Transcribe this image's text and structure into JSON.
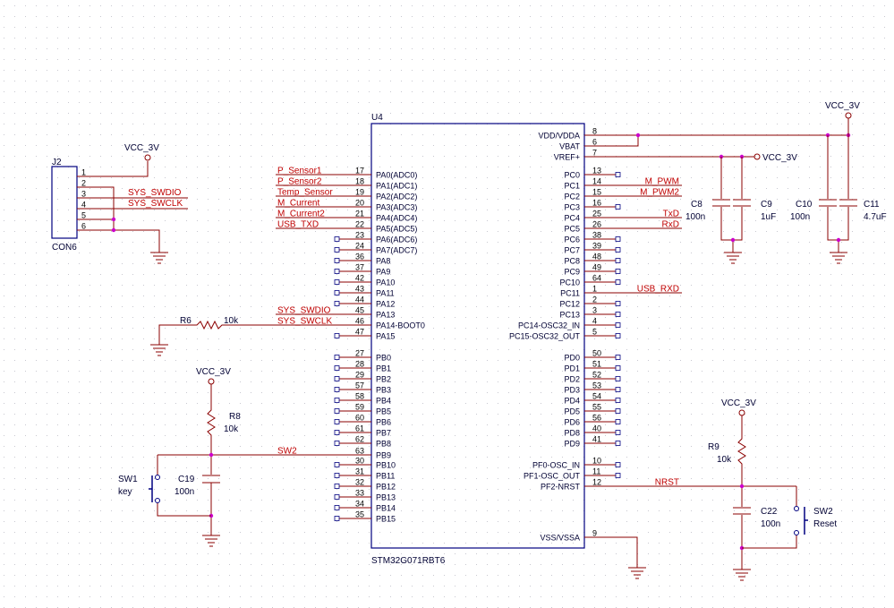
{
  "colors": {
    "wire": "#8b0000",
    "body": "#000080",
    "label": "#000033",
    "net": "#c00000",
    "junction": "#cc00cc"
  },
  "u4": {
    "ref": "U4",
    "part": "STM32G071RBT6",
    "left_pins": [
      {
        "num": "17",
        "name": "PA0(ADC0)",
        "net": "P_Sensor1"
      },
      {
        "num": "18",
        "name": "PA1(ADC1)",
        "net": "P_Sensor2"
      },
      {
        "num": "19",
        "name": "PA2(ADC2)",
        "net": "Temp_Sensor"
      },
      {
        "num": "20",
        "name": "PA3(ADC3)",
        "net": "M_Current"
      },
      {
        "num": "21",
        "name": "PA4(ADC4)",
        "net": "M_Current2"
      },
      {
        "num": "22",
        "name": "PA5(ADC5)",
        "net": "USB_TXD"
      },
      {
        "num": "23",
        "name": "PA6(ADC6)",
        "net": ""
      },
      {
        "num": "24",
        "name": "PA7(ADC7)",
        "net": ""
      },
      {
        "num": "36",
        "name": "PA8",
        "net": ""
      },
      {
        "num": "37",
        "name": "PA9",
        "net": ""
      },
      {
        "num": "42",
        "name": "PA10",
        "net": ""
      },
      {
        "num": "43",
        "name": "PA11",
        "net": ""
      },
      {
        "num": "44",
        "name": "PA12",
        "net": ""
      },
      {
        "num": "45",
        "name": "PA13",
        "net": "SYS_SWDIO"
      },
      {
        "num": "46",
        "name": "PA14-BOOT0",
        "net": "SYS_SWCLK"
      },
      {
        "num": "47",
        "name": "PA15",
        "net": ""
      },
      {
        "num": "27",
        "name": "PB0",
        "net": ""
      },
      {
        "num": "28",
        "name": "PB1",
        "net": ""
      },
      {
        "num": "29",
        "name": "PB2",
        "net": ""
      },
      {
        "num": "57",
        "name": "PB3",
        "net": ""
      },
      {
        "num": "58",
        "name": "PB4",
        "net": ""
      },
      {
        "num": "59",
        "name": "PB5",
        "net": ""
      },
      {
        "num": "60",
        "name": "PB6",
        "net": ""
      },
      {
        "num": "61",
        "name": "PB7",
        "net": ""
      },
      {
        "num": "62",
        "name": "PB8",
        "net": ""
      },
      {
        "num": "63",
        "name": "PB9",
        "net": "SW2"
      },
      {
        "num": "30",
        "name": "PB10",
        "net": ""
      },
      {
        "num": "31",
        "name": "PB11",
        "net": ""
      },
      {
        "num": "32",
        "name": "PB12",
        "net": ""
      },
      {
        "num": "33",
        "name": "PB13",
        "net": ""
      },
      {
        "num": "34",
        "name": "PB14",
        "net": ""
      },
      {
        "num": "35",
        "name": "PB15",
        "net": ""
      }
    ],
    "right_pins": [
      {
        "num": "8",
        "name": "VDD/VDDA",
        "net": ""
      },
      {
        "num": "6",
        "name": "VBAT",
        "net": ""
      },
      {
        "num": "7",
        "name": "VREF+",
        "net": ""
      },
      {
        "num": "13",
        "name": "PC0",
        "net": ""
      },
      {
        "num": "14",
        "name": "PC1",
        "net": "M_PWM"
      },
      {
        "num": "15",
        "name": "PC2",
        "net": "M_PWM2"
      },
      {
        "num": "16",
        "name": "PC3",
        "net": ""
      },
      {
        "num": "25",
        "name": "PC4",
        "net": "TxD"
      },
      {
        "num": "26",
        "name": "PC5",
        "net": "RxD"
      },
      {
        "num": "38",
        "name": "PC6",
        "net": ""
      },
      {
        "num": "39",
        "name": "PC7",
        "net": ""
      },
      {
        "num": "48",
        "name": "PC8",
        "net": ""
      },
      {
        "num": "49",
        "name": "PC9",
        "net": ""
      },
      {
        "num": "64",
        "name": "PC10",
        "net": ""
      },
      {
        "num": "1",
        "name": "PC11",
        "net": "USB_RXD"
      },
      {
        "num": "2",
        "name": "PC12",
        "net": ""
      },
      {
        "num": "3",
        "name": "PC13",
        "net": ""
      },
      {
        "num": "4",
        "name": "PC14-OSC32_IN",
        "net": ""
      },
      {
        "num": "5",
        "name": "PC15-OSC32_OUT",
        "net": ""
      },
      {
        "num": "50",
        "name": "PD0",
        "net": ""
      },
      {
        "num": "51",
        "name": "PD1",
        "net": ""
      },
      {
        "num": "52",
        "name": "PD2",
        "net": ""
      },
      {
        "num": "53",
        "name": "PD3",
        "net": ""
      },
      {
        "num": "54",
        "name": "PD4",
        "net": ""
      },
      {
        "num": "55",
        "name": "PD5",
        "net": ""
      },
      {
        "num": "56",
        "name": "PD6",
        "net": ""
      },
      {
        "num": "40",
        "name": "PD8",
        "net": ""
      },
      {
        "num": "41",
        "name": "PD9",
        "net": ""
      },
      {
        "num": "10",
        "name": "PF0-OSC_IN",
        "net": ""
      },
      {
        "num": "11",
        "name": "PF1-OSC_OUT",
        "net": ""
      },
      {
        "num": "12",
        "name": "PF2-NRST",
        "net": "NRST"
      },
      {
        "num": "9",
        "name": "VSS/VSSA",
        "net": ""
      }
    ]
  },
  "j2": {
    "ref": "J2",
    "part": "CON6",
    "pins": [
      "1",
      "2",
      "3",
      "4",
      "5",
      "6"
    ],
    "nets": [
      "SYS_SWDIO",
      "SYS_SWCLK"
    ],
    "power": "VCC_3V"
  },
  "vref_power": "VCC_3V",
  "vdd_power": "VCC_3V",
  "caps": {
    "c8": {
      "ref": "C8",
      "value": "100n"
    },
    "c9": {
      "ref": "C9",
      "value": "1uF"
    },
    "c10": {
      "ref": "C10",
      "value": "100n"
    },
    "c11": {
      "ref": "C11",
      "value": "4.7uF"
    },
    "c19": {
      "ref": "C19",
      "value": "100n"
    },
    "c22": {
      "ref": "C22",
      "value": "100n"
    }
  },
  "resistors": {
    "r6": {
      "ref": "R6",
      "value": "10k"
    },
    "r8": {
      "ref": "R8",
      "value": "10k"
    },
    "r9": {
      "ref": "R9",
      "value": "10k"
    }
  },
  "switches": {
    "sw1": {
      "ref": "SW1",
      "value": "key"
    },
    "sw2": {
      "ref": "SW2",
      "value": "Reset"
    }
  },
  "sw1_power": "VCC_3V",
  "sw2_power": "VCC_3V"
}
